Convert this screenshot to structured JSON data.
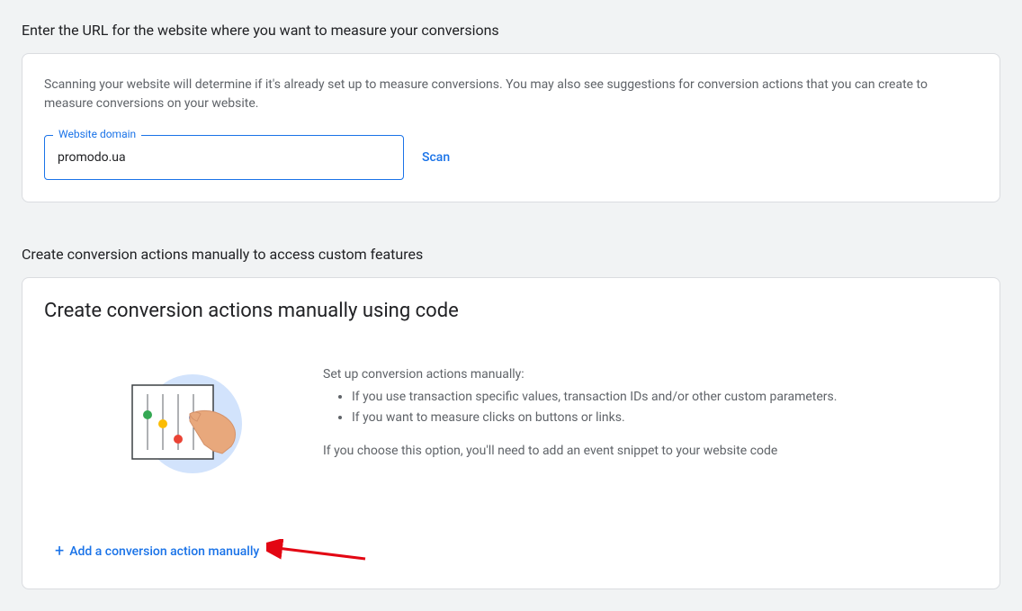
{
  "section1": {
    "heading": "Enter the URL for the website where you want to measure your conversions",
    "description": "Scanning your website will determine if it's already set up to measure conversions. You may also see suggestions for conversion actions that you can create to measure conversions on your website.",
    "inputLabel": "Website domain",
    "inputValue": "promodo.ua",
    "scanButton": "Scan"
  },
  "section2": {
    "heading": "Create conversion actions manually to access custom features",
    "cardTitle": "Create conversion actions manually using code",
    "introText": "Set up conversion actions manually:",
    "bullet1": "If you use transaction specific values, transaction IDs and/or other custom parameters.",
    "bullet2": "If you want to measure clicks on buttons or links.",
    "noteText": "If you choose this option, you'll need to add an event snippet to your website code",
    "addButton": "Add a conversion action manually"
  }
}
